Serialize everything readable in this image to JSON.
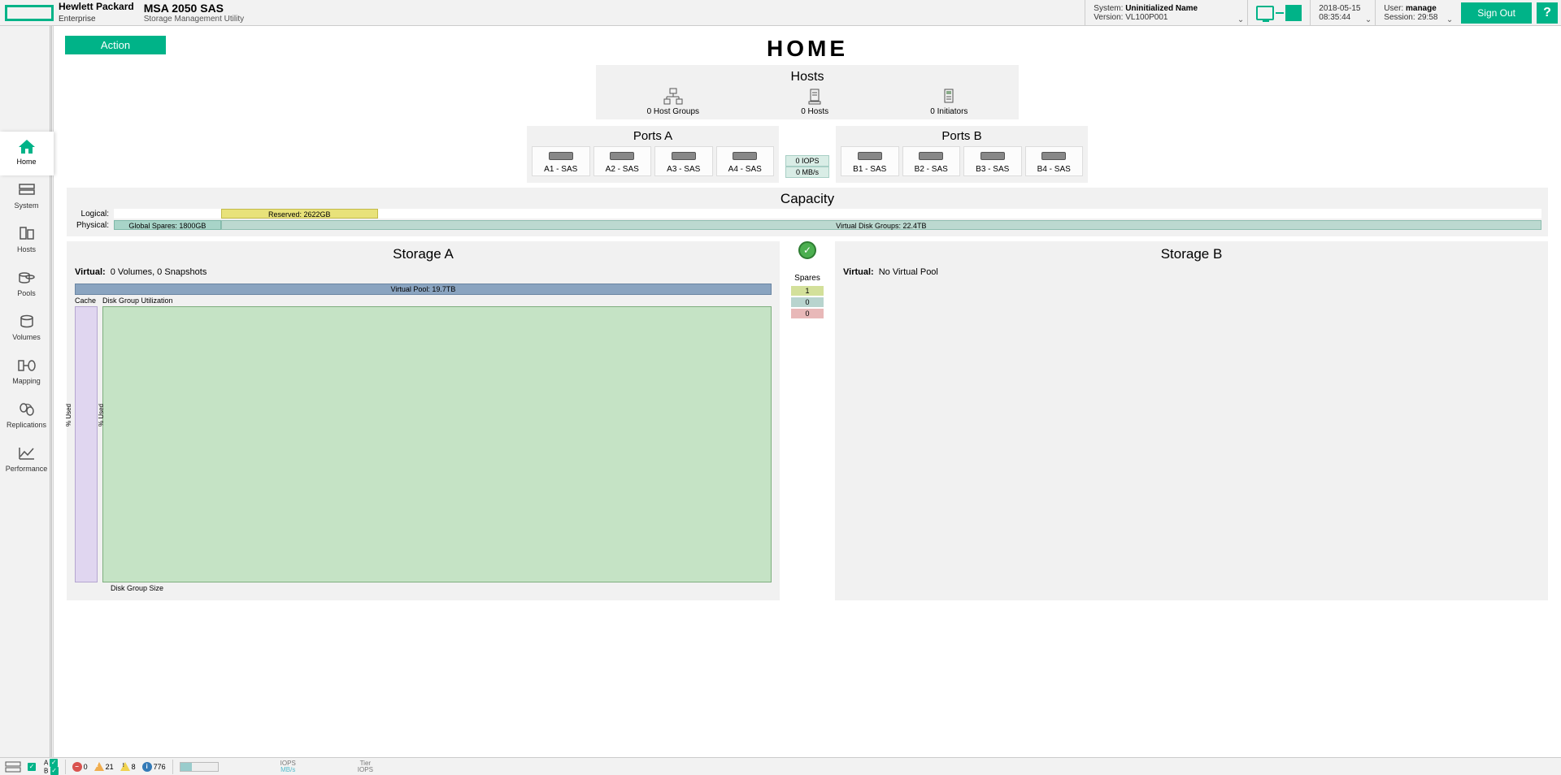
{
  "brand": {
    "l1": "Hewlett Packard",
    "l2": "Enterprise"
  },
  "product": {
    "name": "MSA 2050 SAS",
    "sub": "Storage Management Utility"
  },
  "header": {
    "system_lbl": "System:",
    "system_val": "Uninitialized Name",
    "version_lbl": "Version:",
    "version_val": "VL100P001",
    "date": "2018-05-15",
    "time": "08:35:44",
    "user_lbl": "User:",
    "user_val": "manage",
    "session_lbl": "Session:",
    "session_val": "29:58",
    "signout": "Sign Out",
    "help": "?"
  },
  "action_btn": "Action",
  "page_title": "HOME",
  "nav": [
    {
      "label": "Home"
    },
    {
      "label": "System"
    },
    {
      "label": "Hosts"
    },
    {
      "label": "Pools"
    },
    {
      "label": "Volumes"
    },
    {
      "label": "Mapping"
    },
    {
      "label": "Replications"
    },
    {
      "label": "Performance"
    }
  ],
  "hosts": {
    "title": "Hosts",
    "items": [
      {
        "label": "0 Host Groups"
      },
      {
        "label": "0 Hosts"
      },
      {
        "label": "0 Initiators"
      }
    ]
  },
  "ports": {
    "a_title": "Ports A",
    "b_title": "Ports B",
    "a": [
      "A1 - SAS",
      "A2 - SAS",
      "A3 - SAS",
      "A4 - SAS"
    ],
    "b": [
      "B1 - SAS",
      "B2 - SAS",
      "B3 - SAS",
      "B4 - SAS"
    ],
    "iops": "0 IOPS",
    "mbs": "0 MB/s"
  },
  "capacity": {
    "title": "Capacity",
    "logical_lbl": "Logical:",
    "physical_lbl": "Physical:",
    "reserved": "Reserved: 2622GB",
    "spares": "Global Spares: 1800GB",
    "vdg": "Virtual Disk Groups: 22.4TB"
  },
  "storageA": {
    "title": "Storage A",
    "virt_lbl": "Virtual:",
    "virt_val": "0 Volumes, 0 Snapshots",
    "vp": "Virtual Pool: 19.7TB",
    "cache": "Cache",
    "dgu": "Disk Group Utilization",
    "y1": "% Used",
    "y2": "% Used",
    "xfoot": "Disk Group Size"
  },
  "storageB": {
    "title": "Storage B",
    "virt_lbl": "Virtual:",
    "virt_val": "No Virtual Pool"
  },
  "spares": {
    "title": "Spares",
    "r1": "1",
    "r2": "0",
    "r3": "0"
  },
  "footer": {
    "A": "A",
    "B": "B",
    "err": "0",
    "warn1": "21",
    "warn2": "8",
    "info": "776",
    "m1": "IOPS",
    "m2": "MB/s",
    "m3": "Tier",
    "m4": "IOPS"
  }
}
